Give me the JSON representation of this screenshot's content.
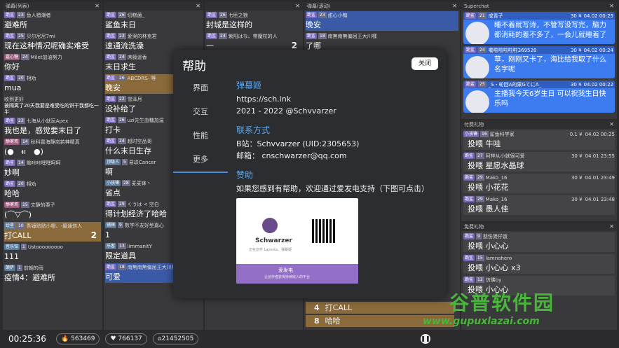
{
  "col1": {
    "title": "弹幕(列表)",
    "items": [
      {
        "badge": "跪鲨",
        "lv": "23",
        "user": "鱼人猎潮者",
        "msg": "避难所"
      },
      {
        "badge": "跪鲨",
        "lv": "25",
        "user": "贝尔尼尼7mi",
        "msg": "现在这种情况呢确实难受"
      },
      {
        "badge": "嘉心糖",
        "lv": "24",
        "user": "Milet加油努力",
        "msg": "你好"
      },
      {
        "badge": "跪鲨",
        "lv": "20",
        "user": "相劝",
        "msg": "mua"
      },
      {
        "badge": "",
        "lv": "",
        "user": "收到更好",
        "msg": "被隔离了20天我要是难受吃的饼干我都吃一半"
      },
      {
        "badge": "跪鲨",
        "lv": "23",
        "user": "七海从小就玩Apex",
        "msg": "我也是，感觉要末日了"
      },
      {
        "badge": "静寒焉",
        "lv": "14",
        "user": "秋科雷海静岚若神精真",
        "msg": "(●　ı̵̵ı　●)"
      },
      {
        "badge": "跪鲨",
        "lv": "14",
        "user": "呦咔咔嘿嘿呵呵",
        "msg": "妙啊"
      },
      {
        "badge": "跪鲨",
        "lv": "20",
        "user": "相劝",
        "msg": "哈哈"
      },
      {
        "badge": "静寒焉",
        "lv": "15",
        "user": "文静的栗子",
        "msg": "(⌒▽⌒)"
      },
      {
        "badge": "绘星",
        "lv": "10",
        "user": "吾锤贴贴小橙、-最通信人",
        "msg": "打CALL",
        "count": "2"
      },
      {
        "badge": "音乐馆",
        "lv": "1",
        "user": "Ustooooooooo",
        "msg": "111"
      },
      {
        "badge": "颠萨",
        "lv": "1",
        "user": "前朝的雨",
        "msg": "疫情4：避难所"
      }
    ]
  },
  "col2": {
    "items": [
      {
        "badge": "跪鲨",
        "lv": "26",
        "user": "切糕菌_",
        "msg": "鲨鱼末日"
      },
      {
        "badge": "跪鲨",
        "lv": "23",
        "user": "爱哭的林克君",
        "msg": "速通流洗澡"
      },
      {
        "badge": "跪鲨",
        "lv": "24",
        "user": "席藤遥香",
        "msg": "末日求生"
      },
      {
        "badge": "跪鲨",
        "lv": "26",
        "user": "ABCDRS- 等",
        "msg": "晚安"
      },
      {
        "badge": "跪鲨",
        "lv": "22",
        "user": "雪泽月",
        "msg": "没补给了"
      },
      {
        "badge": "跪鲨",
        "lv": "26",
        "user": "uzi先生血糖加温",
        "msg": "打卡"
      },
      {
        "badge": "跪鲨",
        "lv": "24",
        "user": "超时空品哥",
        "msg": "什么末日生存"
      },
      {
        "badge": "顶级人",
        "lv": "5",
        "user": "易玖Cancer",
        "msg": "啊"
      },
      {
        "badge": "小孩锋",
        "lv": "28",
        "user": "麦麦锋丶",
        "msg": "省点"
      },
      {
        "badge": "跪鲨",
        "lv": "29",
        "user": "くうは < 空白",
        "msg": "得计划经济了哈哈"
      },
      {
        "badge": "铺辣",
        "lv": "9",
        "user": "数学不友好型嘉心",
        "msg": "1"
      },
      {
        "badge": "乐客",
        "lv": "13",
        "user": "limmanitY",
        "msg": "限定道具"
      },
      {
        "badge": "跪鲨",
        "lv": "18",
        "user": "南無南無偏屈王大川樣",
        "msg": "可爱"
      }
    ]
  },
  "col3": {
    "items": [
      {
        "badge": "跪鲨",
        "lv": "26",
        "user": "七臣之狼",
        "msg": "封城是这样的"
      },
      {
        "badge": "跪鲨",
        "lv": "24",
        "user": "紫阳はな、带魔杖的人",
        "msg": "一",
        "count": "2"
      }
    ]
  },
  "col4": {
    "title": "弹幕(滚动)",
    "items": [
      {
        "badge": "跪鲨",
        "lv": "23",
        "user": "甜心小糖",
        "msg": "晚安"
      },
      {
        "badge": "跪鲨",
        "lv": "18",
        "user": "南無南無偏屈王大川樣",
        "msg": "了哪"
      }
    ],
    "bottom": [
      {
        "num": "4",
        "msg": "打CALL"
      },
      {
        "num": "8",
        "msg": "哈哈"
      }
    ]
  },
  "superchat": {
    "title": "Superchat",
    "items": [
      {
        "badge": "跪鲨",
        "lv": "21",
        "user": "成青子",
        "price": "30 ¥",
        "time": "04.02 00:25",
        "msg": "睡不着就写诗，不管写没写完，脑力都消耗的差不多了，一会儿就睡着了"
      },
      {
        "badge": "跪鲨",
        "lv": "24",
        "user": "嘞啦啦啦啦啦369528",
        "price": "30 ¥",
        "time": "04.02 00:24",
        "msg": "草，刚刚又卡了，海比给我取了什么名字呢"
      },
      {
        "badge": "跪鲨",
        "lv": "25",
        "user": "_S・轮回A的果GてにA_",
        "price": "30 ¥",
        "time": "04.02 00:22",
        "msg": "主播我今天6岁生日 可以祝我生日快乐吗"
      }
    ]
  },
  "paid_gifts": {
    "title": "付费礼物",
    "items": [
      {
        "badge": "小孩锋",
        "lv": "16",
        "user": "鲨鱼科学家",
        "price": "0.1 ¥",
        "time": "04.02 00:25",
        "msg": "投喂 牛哇"
      },
      {
        "badge": "跪鲨",
        "lv": "27",
        "user": "阿梓从小就很可爱",
        "price": "30 ¥",
        "time": "04.01 23:55",
        "msg": "投喂 星愿水晶球"
      },
      {
        "badge": "跪鲨",
        "lv": "29",
        "user": "Mako_16",
        "price": "30 ¥",
        "time": "04.01 23:49",
        "msg": "投喂 小花花"
      },
      {
        "badge": "跪鲨",
        "lv": "29",
        "user": "Mako_16",
        "price": "30 ¥",
        "time": "04.01 23:48",
        "msg": "投喂 愚人佳"
      }
    ]
  },
  "free_gifts": {
    "title": "免费礼物",
    "items": [
      {
        "badge": "跪鲨",
        "lv": "9",
        "user": "悲伤煲仔饭",
        "msg": "投喂 小心心"
      },
      {
        "badge": "跪鲨",
        "lv": "15",
        "user": "lamnohero",
        "msg": "投喂 小心心 x3"
      },
      {
        "badge": "跪鲨",
        "lv": "12",
        "user": "仿佛by",
        "msg": "投喂 小心心"
      }
    ]
  },
  "modal": {
    "title": "帮助",
    "close_label": "关闭",
    "nav": [
      "界面",
      "交互",
      "性能",
      "更多"
    ],
    "active_nav": 3,
    "app_name": "弹幕姬",
    "url": "https://sch.ink",
    "copyright": "2021 - 2022 @Schvvarzer",
    "contact_title": "联系方式",
    "bilibili": "B站：Schvvarzer (UID:2305653)",
    "email": "邮箱：  cnschwarzer@qq.com",
    "sponsor_title": "赞助",
    "sponsor_text": "如果您感到有帮助，欢迎通过爱发电支持（下图可点击）",
    "card_name": "Schwarzer",
    "card_sub": "正在创作 Layesta、弹幕姬",
    "card_brand": "爱发电",
    "card_slogan": "让创作者获得持续收入的平台"
  },
  "bottom": {
    "time": "00:25:36",
    "stat1": "563469",
    "stat2": "766137",
    "stat3": "21452505"
  },
  "watermark": {
    "cn": "谷普软件园",
    "url": "www.gupuxlazai.com"
  }
}
